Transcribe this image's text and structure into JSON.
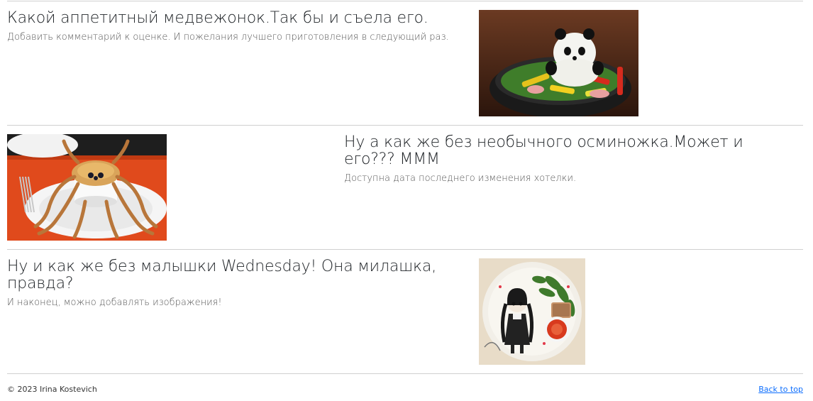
{
  "features": [
    {
      "heading": "Какой аппетитный медвежонок.Так бы и съела его.",
      "text": "Добавить комментарий к оценке. И пожелания лучшего приготовления в следующий раз.",
      "image_subject": "panda-rice-dish"
    },
    {
      "heading": "Ну а как же без необычного осминожка.Может и его??? МММ",
      "text": "Доступна дата последнего изменения хотелки.",
      "image_subject": "octopus-pie"
    },
    {
      "heading": "Ну и как же без малышки Wednesday! Она милашка, правда?",
      "text": "И наконец, можно добавлять изображения!",
      "image_subject": "wednesday-food-art"
    }
  ],
  "footer": {
    "copyright": "© 2023 Irina Kostevich",
    "back_to_top": "Back to top"
  },
  "colors": {
    "link": "#0d6efd",
    "divider": "#d0d0d0",
    "text": "#212529",
    "muted": "#555555"
  }
}
